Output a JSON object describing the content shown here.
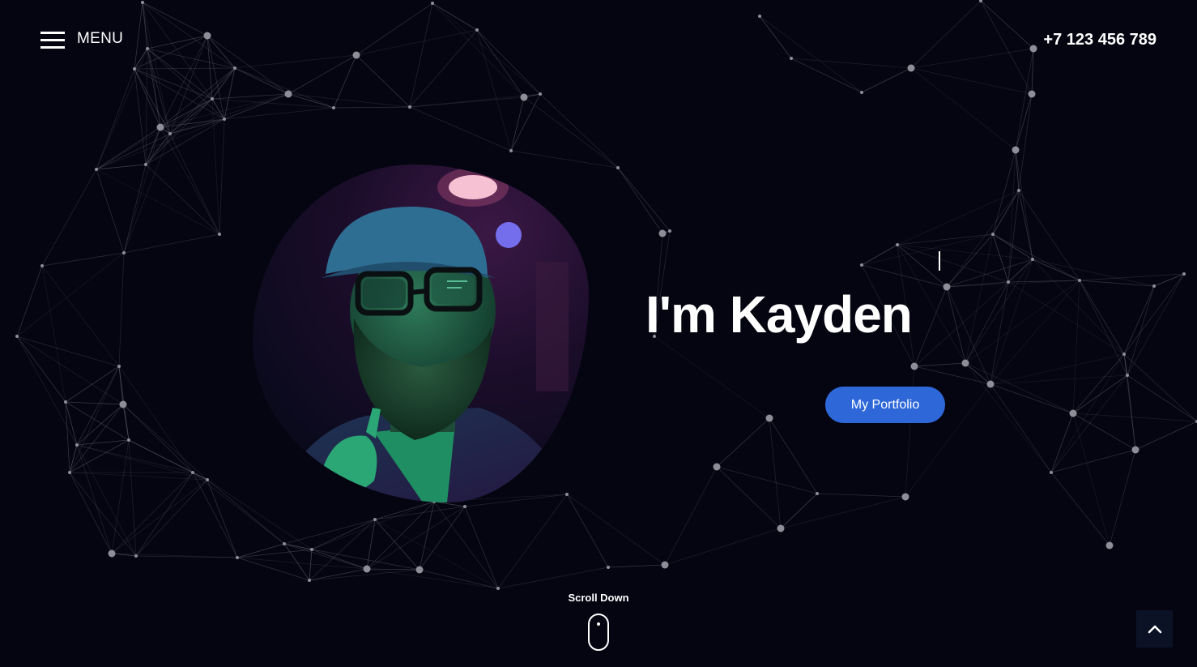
{
  "header": {
    "menu_label": "MENU",
    "phone": "+7 123 456 789"
  },
  "hero": {
    "title": "I'm Kayden",
    "portfolio_button": "My Portfolio"
  },
  "scroll": {
    "label": "Scroll Down"
  },
  "icons": {
    "menu": "hamburger-menu-icon",
    "mouse": "mouse-scroll-icon",
    "back_to_top": "chevron-up-icon"
  },
  "colors": {
    "background": "#050512",
    "accent": "#2d67d8",
    "network_node": "#8a8a96",
    "network_line": "#55555f",
    "back_to_top_bg": "#0c1226"
  }
}
